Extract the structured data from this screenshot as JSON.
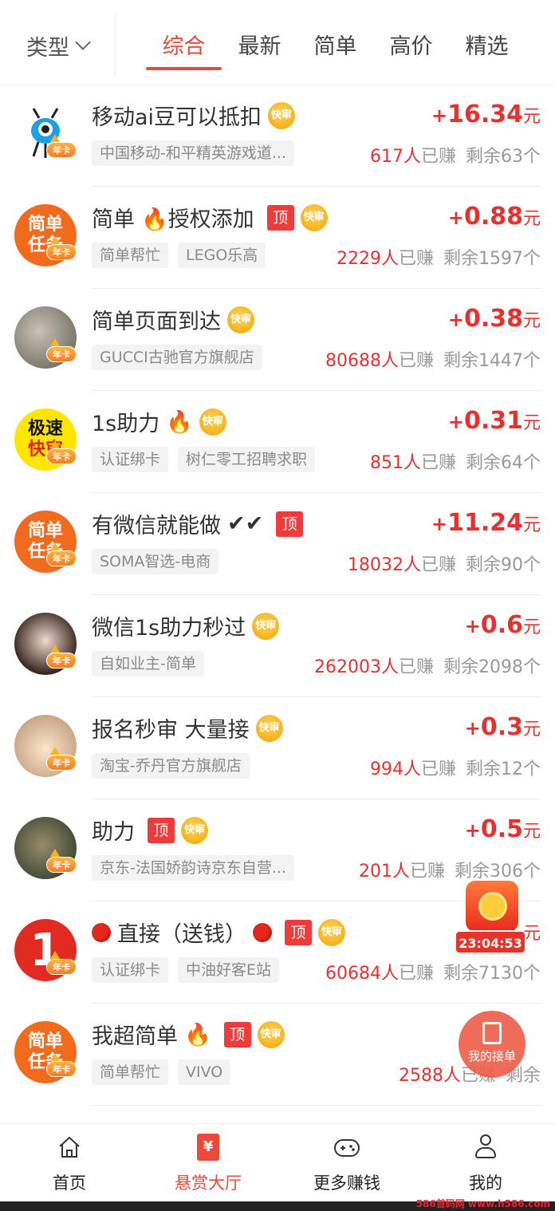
{
  "filter": {
    "label": "类型"
  },
  "tabs": [
    {
      "label": "综合",
      "active": true
    },
    {
      "label": "最新",
      "active": false
    },
    {
      "label": "简单",
      "active": false
    },
    {
      "label": "高价",
      "active": false
    },
    {
      "label": "精选",
      "active": false
    }
  ],
  "tasks": [
    {
      "title": "移动ai豆可以抵扣",
      "extra": "",
      "top": false,
      "fast": true,
      "avatar": "ant",
      "price_sign": "+",
      "price": "16.34",
      "unit": "元",
      "tags": [
        "中国移动-和平精英游戏道..."
      ],
      "earned": "617人",
      "earned_suffix": "已赚",
      "remain": "剩余63个"
    },
    {
      "title": "简单",
      "extra": "🔥授权添加",
      "top": true,
      "fast": true,
      "avatar": "simple",
      "price_sign": "+",
      "price": "0.88",
      "unit": "元",
      "tags": [
        "简单帮忙",
        "LEGO乐高"
      ],
      "earned": "2229人",
      "earned_suffix": "已赚",
      "remain": "剩余1597个"
    },
    {
      "title": "简单页面到达",
      "extra": "",
      "top": false,
      "fast": true,
      "avatar": "photo1",
      "price_sign": "+",
      "price": "0.38",
      "unit": "元",
      "tags": [
        "GUCCI古驰官方旗舰店"
      ],
      "earned": "80688人",
      "earned_suffix": "已赚",
      "remain": "剩余1447个"
    },
    {
      "title": "1s助力",
      "extra": "🔥",
      "top": false,
      "fast": true,
      "avatar": "fast",
      "price_sign": "+",
      "price": "0.31",
      "unit": "元",
      "tags": [
        "认证绑卡",
        "树仁零工招聘求职"
      ],
      "earned": "851人",
      "earned_suffix": "已赚",
      "remain": "剩余64个"
    },
    {
      "title": "有微信就能做",
      "extra": "✔✔",
      "top": true,
      "fast": false,
      "avatar": "simple",
      "price_sign": "+",
      "price": "11.24",
      "unit": "元",
      "tags": [
        "SOMA智选-电商"
      ],
      "earned": "18032人",
      "earned_suffix": "已赚",
      "remain": "剩余90个"
    },
    {
      "title": "微信1s助力秒过",
      "extra": "",
      "top": false,
      "fast": true,
      "avatar": "photo2",
      "price_sign": "+",
      "price": "0.6",
      "unit": "元",
      "tags": [
        "自如业主-简单"
      ],
      "earned": "262003人",
      "earned_suffix": "已赚",
      "remain": "剩余2098个"
    },
    {
      "title": "报名秒审 大量接",
      "extra": "",
      "top": false,
      "fast": true,
      "avatar": "photo3",
      "price_sign": "+",
      "price": "0.3",
      "unit": "元",
      "tags": [
        "淘宝-乔丹官方旗舰店"
      ],
      "earned": "994人",
      "earned_suffix": "已赚",
      "remain": "剩余12个"
    },
    {
      "title": "助力",
      "extra": "",
      "top": true,
      "fast": true,
      "avatar": "photo4",
      "price_sign": "+",
      "price": "0.5",
      "unit": "元",
      "tags": [
        "京东-法国娇韵诗京东自营..."
      ],
      "earned": "201人",
      "earned_suffix": "已赚",
      "remain": "剩余306个"
    },
    {
      "title": "直接（送钱）",
      "extra": "",
      "top": true,
      "fast": true,
      "avatar": "one",
      "price_sign": "",
      "price": "",
      "unit": "元",
      "tags": [
        "认证绑卡",
        "中油好客E站"
      ],
      "earned": "60684人",
      "earned_suffix": "已赚",
      "remain": "剩余7130个"
    },
    {
      "title": "我超简单",
      "extra": "🔥",
      "top": true,
      "fast": true,
      "avatar": "simple",
      "price_sign": "",
      "price": "",
      "unit": "",
      "tags": [
        "简单帮忙",
        "VIVO"
      ],
      "earned": "2588人",
      "earned_suffix": "已赚",
      "remain": "剩余"
    }
  ],
  "labels": {
    "top": "顶",
    "fast": "快审",
    "year": "年卡",
    "simple_l1": "简单",
    "simple_l2": "任务",
    "fast_l1": "极速",
    "fast_l2": "快审",
    "one": "1"
  },
  "float": {
    "timer": "23:04:53",
    "my_orders": "我的接单"
  },
  "nav": [
    {
      "label": "首页",
      "icon": "home-icon",
      "active": false
    },
    {
      "label": "悬赏大厅",
      "icon": "yen-icon",
      "active": true
    },
    {
      "label": "更多赚钱",
      "icon": "gamepad-icon",
      "active": false
    },
    {
      "label": "我的",
      "icon": "user-icon",
      "active": false
    }
  ],
  "watermark": "586首码网 www.h586.com"
}
